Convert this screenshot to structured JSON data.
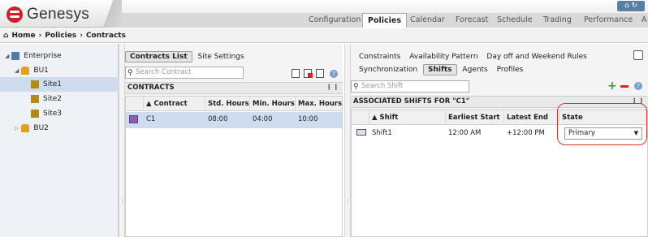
{
  "app": {
    "brand": "Genesys"
  },
  "nav": {
    "tabs": [
      "Configuration",
      "Policies",
      "Calendar",
      "Forecast",
      "Schedule",
      "Trading",
      "Performance",
      "A"
    ],
    "active": "Policies"
  },
  "breadcrumb": [
    "Home",
    "Policies",
    "Contracts"
  ],
  "tree": {
    "items": [
      "Enterprise",
      "BU1",
      "Site1",
      "Site2",
      "Site3",
      "BU2"
    ],
    "selected": "Site1"
  },
  "contracts": {
    "tabs": [
      "Contracts List",
      "Site Settings"
    ],
    "search_placeholder": "Search Contract",
    "section_title": "CONTRACTS",
    "columns": [
      "Contract",
      "Std. Hours",
      "Min. Hours",
      "Max. Hours"
    ],
    "rows": [
      {
        "name": "C1",
        "std": "08:00",
        "min": "04:00",
        "max": "10:00"
      }
    ]
  },
  "right": {
    "tabs_row1": [
      "Constraints",
      "Availability Pattern",
      "Day off and Weekend Rules"
    ],
    "tabs_row2": [
      "Synchronization",
      "Shifts",
      "Agents",
      "Profiles"
    ],
    "active_tab": "Shifts",
    "search_placeholder": "Search Shift",
    "section_title": "ASSOCIATED SHIFTS FOR \"C1\"",
    "columns": [
      "Shift",
      "Earliest Start",
      "Latest End",
      "State"
    ],
    "rows": [
      {
        "shift": "Shift1",
        "start": "12:00 AM",
        "end": "+12:00 PM",
        "state": "Primary"
      }
    ]
  },
  "colors": {
    "accent": "#cf2027",
    "selection": "#cfdcef",
    "highlight_ring": "#e0322a"
  }
}
